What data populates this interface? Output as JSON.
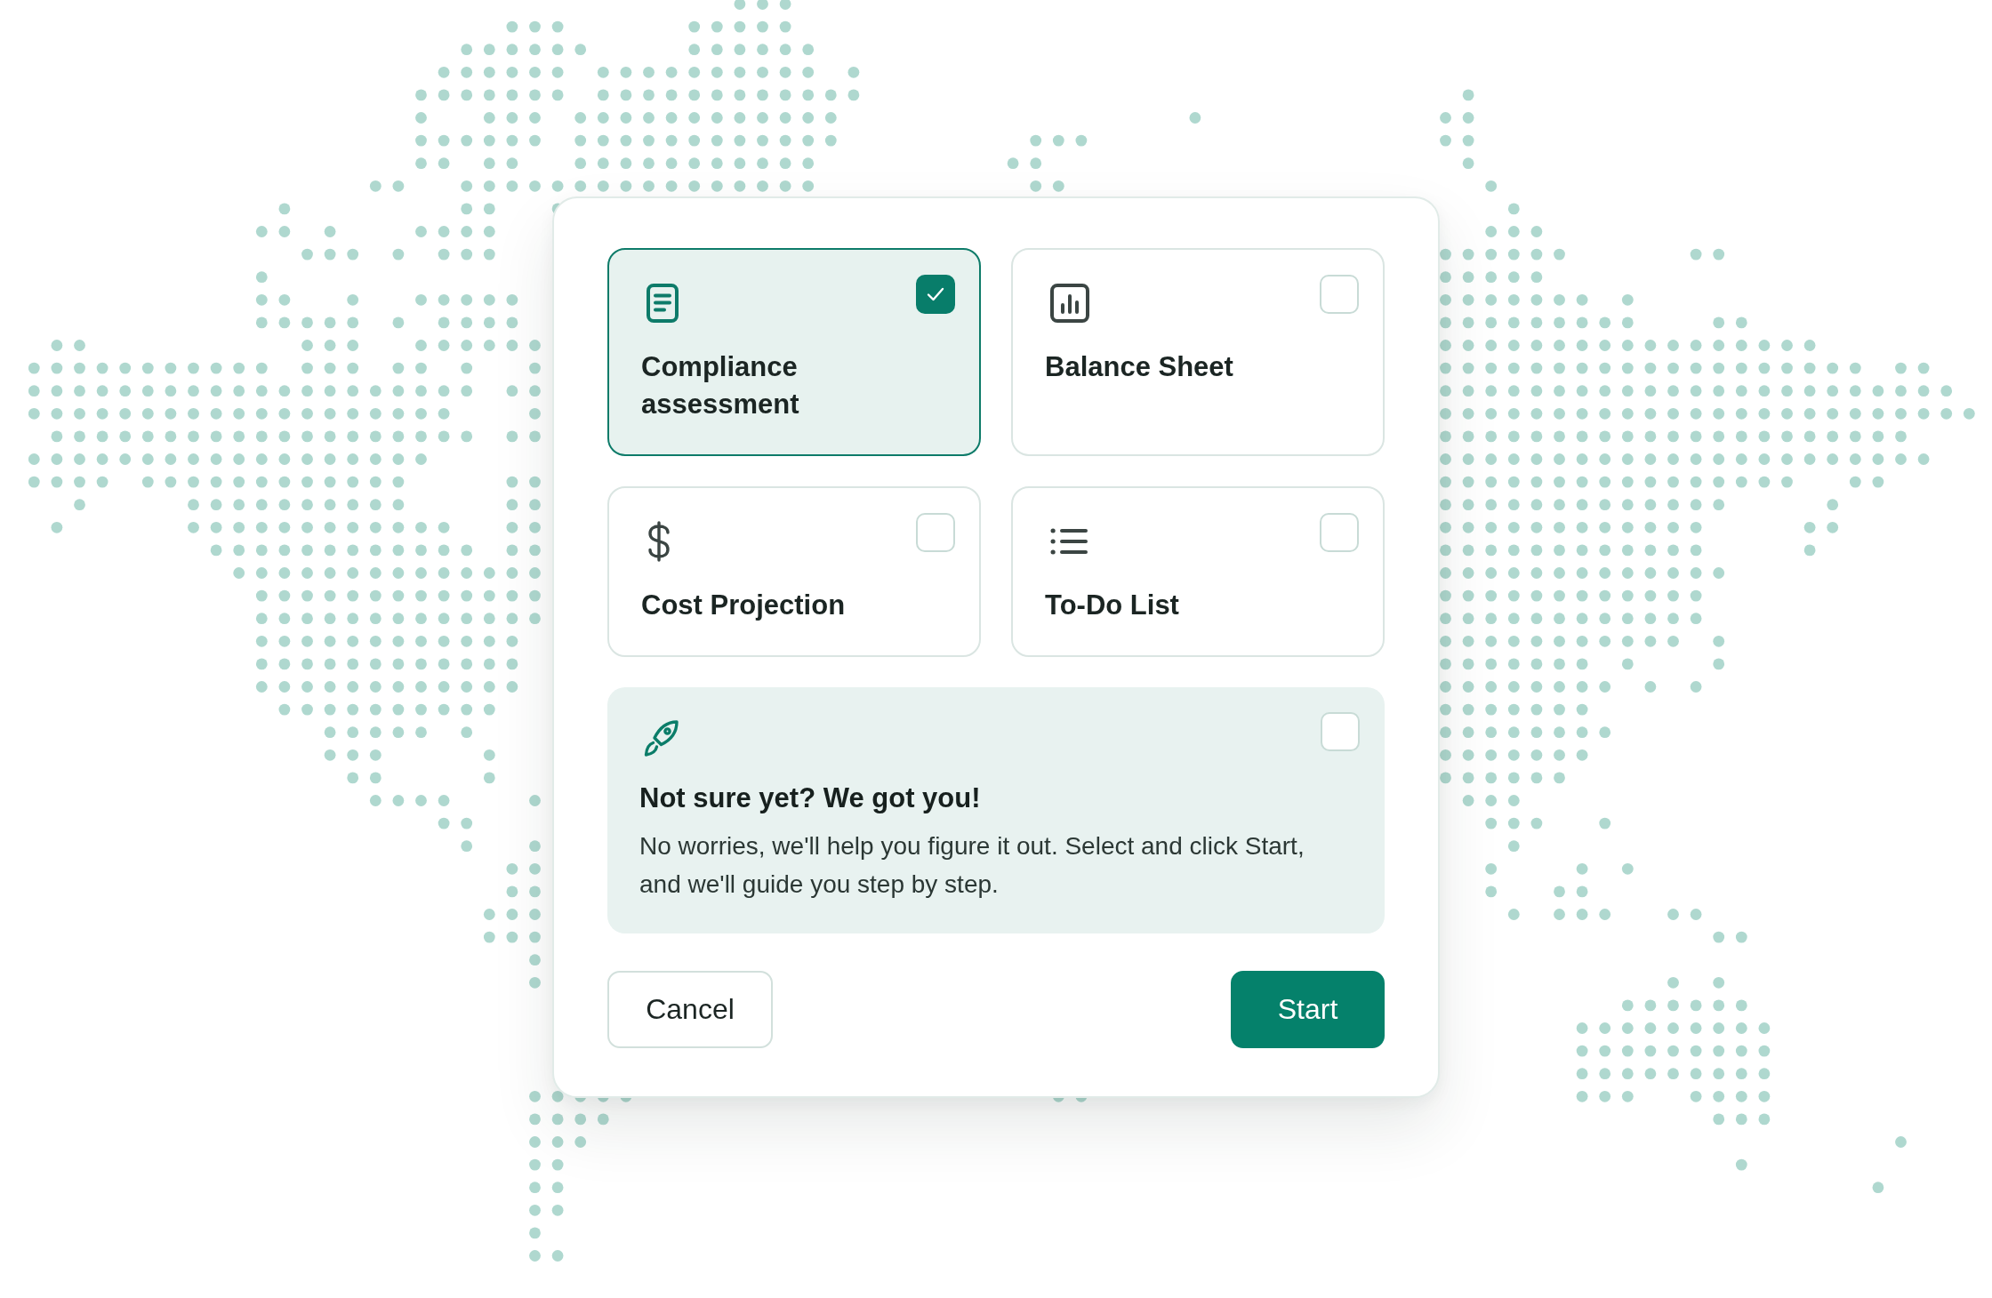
{
  "dialog": {
    "options": [
      {
        "label": "Compliance assessment",
        "selected": true
      },
      {
        "label": "Balance Sheet",
        "selected": false
      },
      {
        "label": "Cost Projection",
        "selected": false
      },
      {
        "label": "To-Do List",
        "selected": false
      }
    ],
    "guided_option": {
      "title": "Not sure yet? We got you!",
      "description": "No worries, we'll help you figure it out. Select and click Start, and we'll guide you step by step.",
      "selected": false
    },
    "buttons": [
      {
        "label": "Cancel",
        "kind": "secondary"
      },
      {
        "label": "Start",
        "kind": "primary"
      }
    ]
  }
}
